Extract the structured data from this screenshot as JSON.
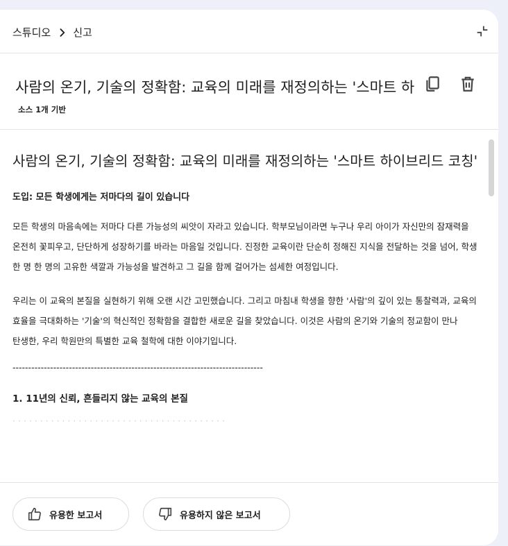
{
  "breadcrumb": {
    "root": "스튜디오",
    "current": "신고"
  },
  "header": {
    "title": "사람의 온기, 기술의 정확함: 교육의 미래를 재정의하는 '스마트 하이브리드 코칭'",
    "sources_label": "소스 1개 기반"
  },
  "document": {
    "title": "사람의 온기, 기술의 정확함: 교육의 미래를 재정의하는 '스마트 하이브리드 코칭'",
    "intro_heading": "도입: 모든 학생에게는 저마다의 길이 있습니다",
    "paragraph_1": "모든 학생의 마음속에는 저마다 다른 가능성의 씨앗이 자라고 있습니다. 학부모님이라면 누구나 우리 아이가 자신만의 잠재력을 온전히 꽃피우고, 단단하게 성장하기를 바라는 마음일 것입니다. 진정한 교육이란 단순히 정해진 지식을 전달하는 것을 넘어, 학생 한 명 한 명의 고유한 색깔과 가능성을 발견하고 그 길을 함께 걸어가는 섬세한 여정입니다.",
    "paragraph_2": "우리는 이 교육의 본질을 실현하기 위해 오랜 시간 고민했습니다. 그리고 마침내 학생을 향한 '사람'의 깊이 있는 통찰력과, 교육의 효율을 극대화하는 '기술'의 혁신적인 정확함을 결합한 새로운 길을 찾았습니다. 이것은 사람의 온기와 기술의 정교함이 만나 탄생한, 우리 학원만의 특별한 교육 철학에 대한 이야기입니다.",
    "divider": "--------------------------------------------------------------------------------",
    "section_1_heading": "1. 11년의 신뢰, 흔들리지 않는 교육의 본질"
  },
  "footer": {
    "good_label": "유용한 보고서",
    "bad_label": "유용하지 않은 보고서"
  },
  "icons": {
    "breadcrumb_separator": "chevron-right-icon",
    "collapse": "collapse-icon",
    "copy": "copy-icon",
    "delete": "trash-icon",
    "thumbs_up": "thumbs-up-icon",
    "thumbs_down": "thumbs-down-icon"
  }
}
